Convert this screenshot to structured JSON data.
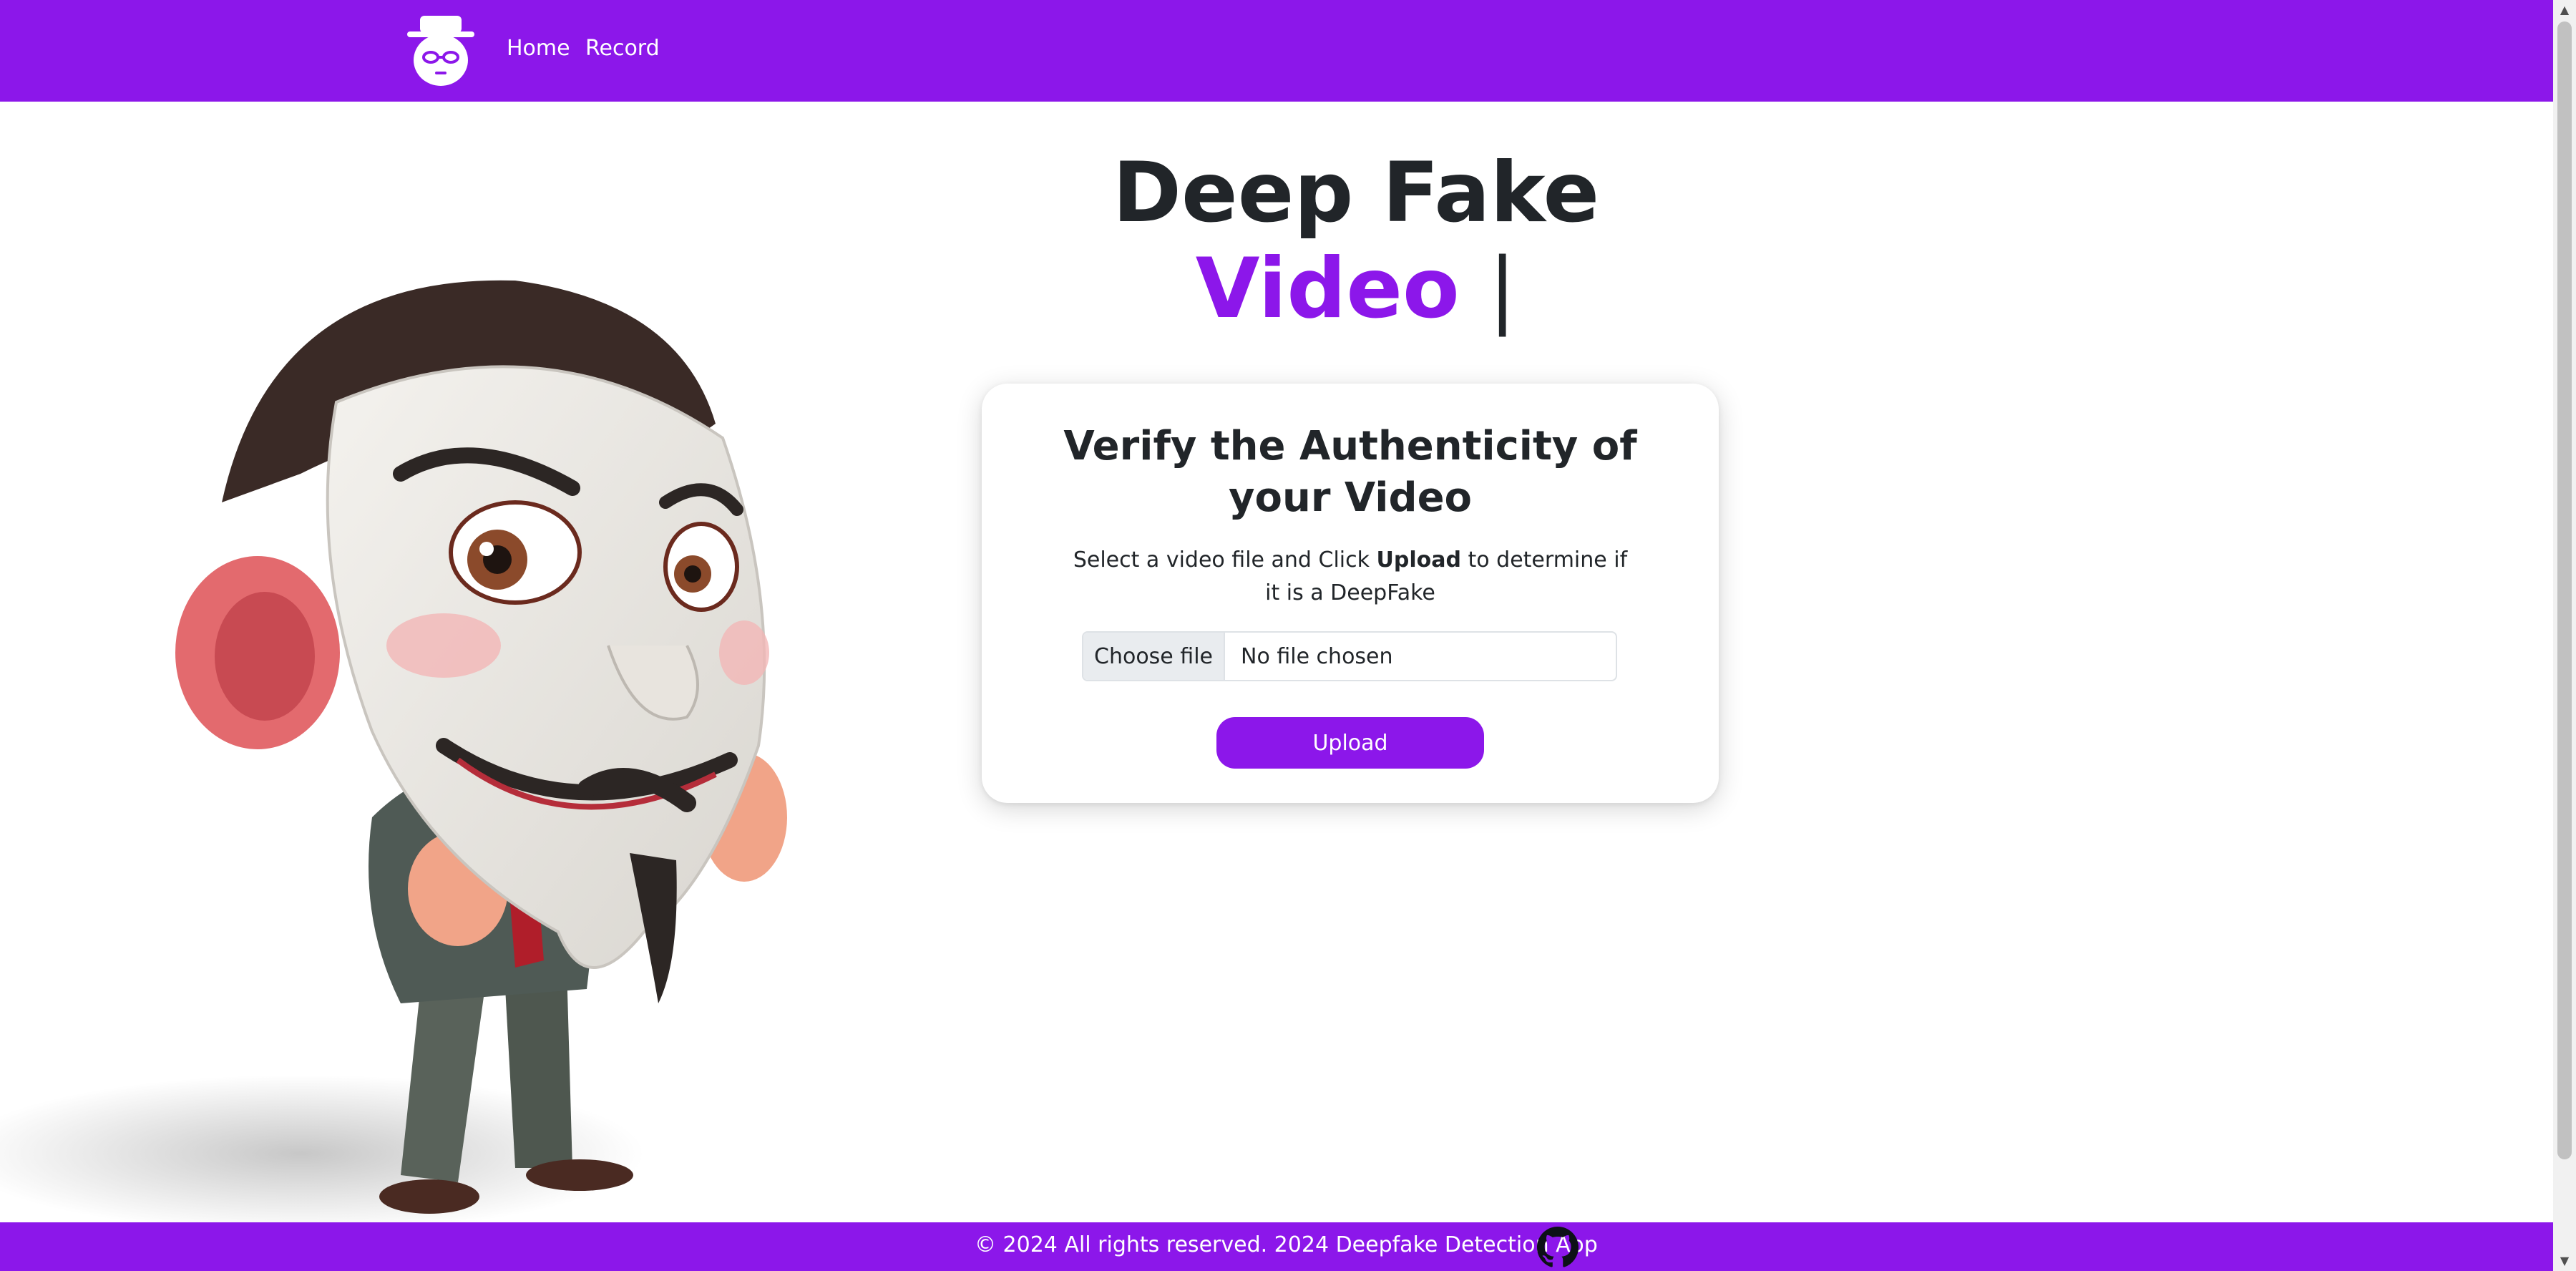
{
  "navbar": {
    "logo_icon": "spy-icon",
    "links": [
      {
        "label": "Home"
      },
      {
        "label": "Record"
      }
    ],
    "background": "#8c17ea"
  },
  "hero": {
    "title_line1": "Deep Fake",
    "title_word": "Video",
    "title_cursor": "|",
    "illustration": "masked-cartoon-man"
  },
  "card": {
    "title": "Verify the Authenticity of your Video",
    "desc_before": "Select a video file and Click ",
    "desc_bold": "Upload",
    "desc_after": " to determine if it is a DeepFake",
    "file_button": "Choose file",
    "file_status": "No file chosen",
    "upload_label": "Upload"
  },
  "footer": {
    "text": "© 2024 All rights reserved. 2024 Deepfake Detection App",
    "icon": "github-icon"
  },
  "colors": {
    "accent": "#8c17ea",
    "text": "#212529"
  }
}
